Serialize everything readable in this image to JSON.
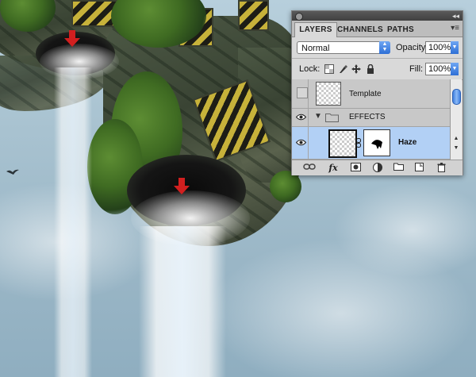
{
  "panel": {
    "tabs": [
      {
        "label": "LAYERS",
        "active": true
      },
      {
        "label": "CHANNELS",
        "active": false
      },
      {
        "label": "PATHS",
        "active": false
      }
    ],
    "menu_icon": "panel-menu-icon",
    "blend_mode": "Normal",
    "opacity_label": "Opacity:",
    "opacity_value": "100%",
    "lock_label": "Lock:",
    "fill_label": "Fill:",
    "fill_value": "100%",
    "layers": [
      {
        "name": "Template",
        "visible": false,
        "selected": false,
        "type": "layer"
      },
      {
        "name": "EFFECTS",
        "visible": true,
        "selected": false,
        "type": "group"
      },
      {
        "name": "Haze",
        "visible": true,
        "selected": true,
        "type": "layer-with-mask"
      }
    ],
    "toolbar_icons": [
      "link-layers-icon",
      "fx-icon",
      "layer-mask-icon",
      "adjustment-layer-icon",
      "new-group-icon",
      "new-layer-icon",
      "trash-icon"
    ],
    "colors": {
      "selection": "#b2d0f5",
      "accent_blue": "#2e6fd6"
    }
  }
}
